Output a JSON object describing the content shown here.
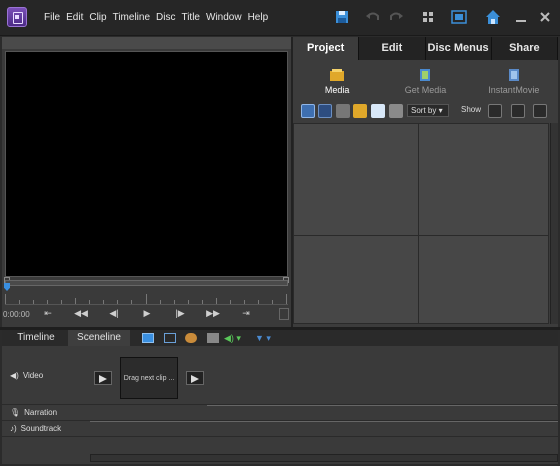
{
  "menu": [
    "File",
    "Edit",
    "Clip",
    "Timeline",
    "Disc",
    "Title",
    "Window",
    "Help"
  ],
  "monitor": {
    "timecode": "0:00:00"
  },
  "project_panel": {
    "tabs": [
      "Project",
      "Edit",
      "Disc Menus",
      "Share"
    ],
    "active_tab": "Project",
    "subtabs": [
      "Media",
      "Get Media",
      "InstantMovie"
    ],
    "active_subtab": "Media",
    "sort_label": "Sort by",
    "show_label": "Show"
  },
  "bottom_panel": {
    "tabs": [
      "Timeline",
      "Sceneline"
    ],
    "active_tab": "Sceneline",
    "tracks": {
      "video": "Video",
      "narration": "Narration",
      "soundtrack": "Soundtrack"
    },
    "clip_placeholder": "Drag next clip ..."
  },
  "colors": {
    "accent": "#3a8fe0",
    "logo": "#6b3fa8"
  }
}
